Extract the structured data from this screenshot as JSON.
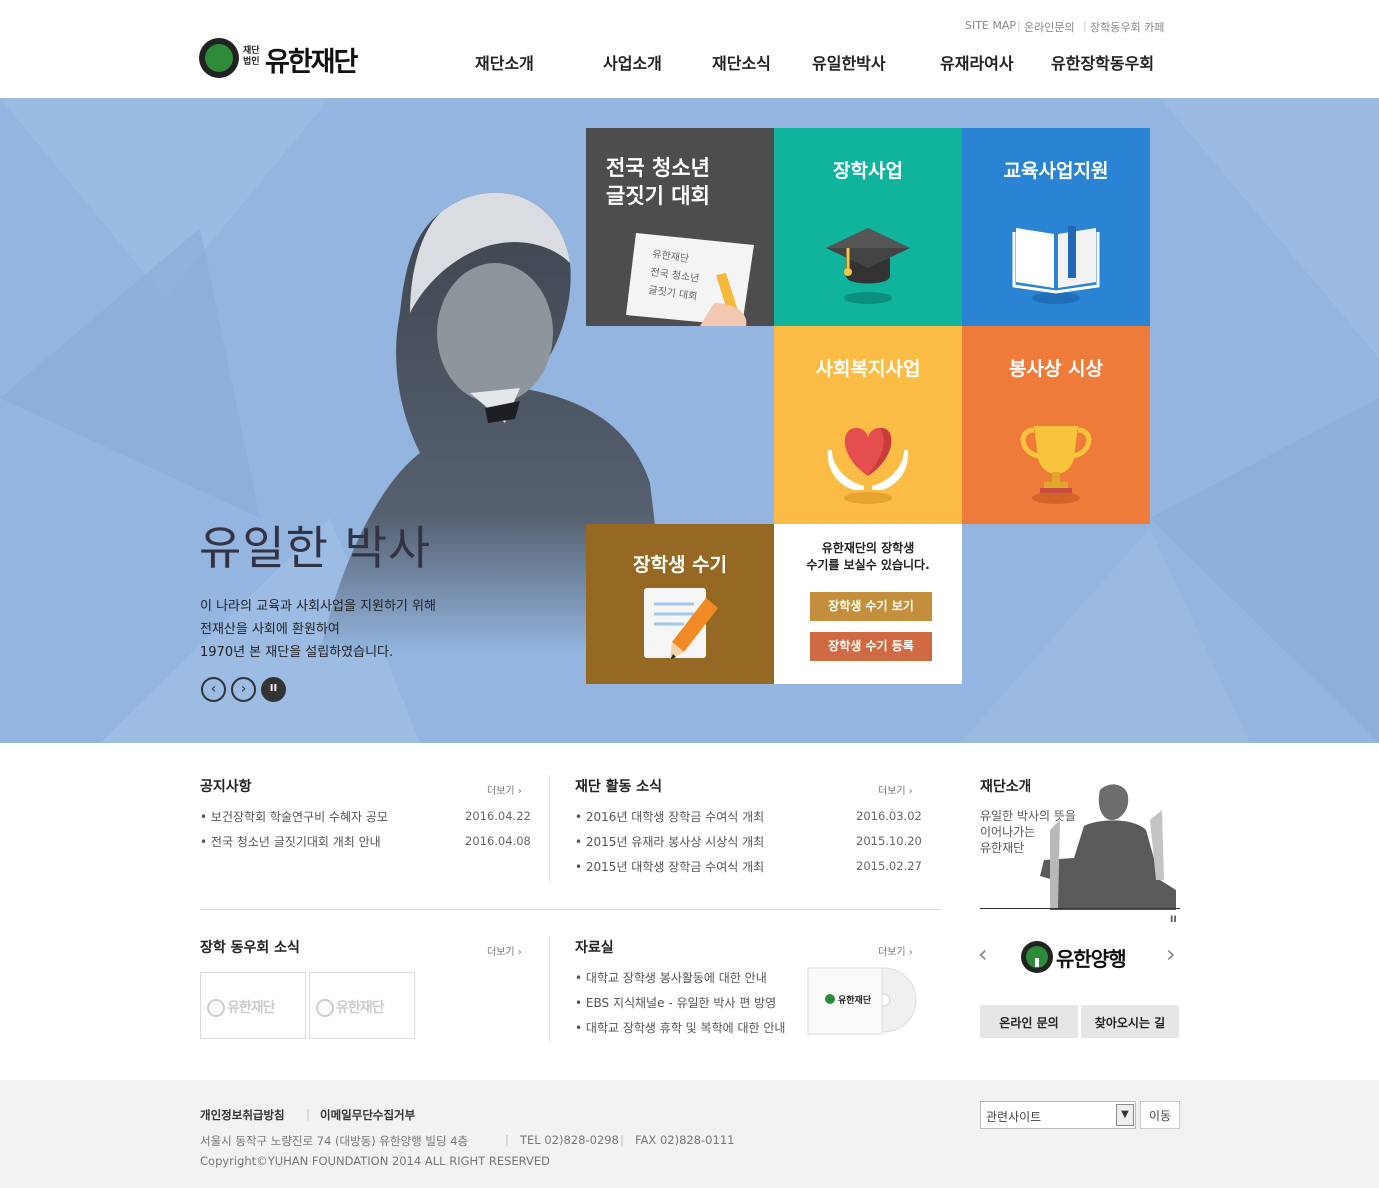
{
  "util": {
    "sitemap": "SITE MAP",
    "inquiry": "온라인문의",
    "cafe": "장학동우회 카페"
  },
  "logo": {
    "small": "재단\n법인",
    "text": "유한재단"
  },
  "gnb": [
    "재단소개",
    "사업소개",
    "재단소식",
    "유일한박사",
    "유재라여사",
    "유한장학동우회"
  ],
  "hero": {
    "title": "유일한 박사",
    "desc": [
      "이 나라의 교육과 사회사업을 지원하기 위해",
      "전재산을 사회에 환원하여",
      "1970년 본 재단을 설립하였습니다."
    ],
    "prev": "‹",
    "next": "›",
    "pause": "II"
  },
  "tiles": {
    "essay": {
      "title1": "전국 청소년",
      "title2": "글짓기 대회",
      "paper": [
        "유한재단",
        "전국 청소년",
        "글짓기 대회"
      ]
    },
    "scholar": {
      "title": "장학사업"
    },
    "edu": {
      "title": "교육사업지원"
    },
    "welfare": {
      "title": "사회복지사업"
    },
    "award": {
      "title": "봉사상 시상"
    },
    "memoir": {
      "title": "장학생 수기",
      "desc1": "유한재단의 장학생",
      "desc2": "수기를 보실수 있습니다.",
      "view": "장학생 수기 보기",
      "register": "장학생 수기 등록"
    }
  },
  "colors": {
    "hero_bg": "#93b5df",
    "essay": "#4d4d4d",
    "scholar": "#10b39c",
    "edu": "#2a84d3",
    "welfare": "#fbbc45",
    "award": "#ef7b3a",
    "memoir": "#956823"
  },
  "notice": {
    "title": "공지사항",
    "more": "더보기 ›",
    "items": [
      {
        "text": "보건장학회 학술연구비 수혜자 공모",
        "date": "2016.04.22"
      },
      {
        "text": "전국 청소년 글짓기대회 개최 안내",
        "date": "2016.04.08"
      }
    ]
  },
  "activity": {
    "title": "재단 활동 소식",
    "more": "더보기 ›",
    "items": [
      {
        "text": "2016년 대학생 장학금 수여식 개최",
        "date": "2016.03.02"
      },
      {
        "text": "2015년 유재라 봉사상 시상식 개최",
        "date": "2015.10.20"
      },
      {
        "text": "2015년 대학생 장학금 수여식 개최",
        "date": "2015.02.27"
      }
    ]
  },
  "alumni": {
    "title": "장학 동우회 소식",
    "more": "더보기 ›",
    "thumb_logo": "유한재단"
  },
  "archive": {
    "title": "자료실",
    "more": "더보기 ›",
    "items": [
      "대학교 장학생 봉사활동에 대한 안내",
      "EBS 지식채널e - 유일한 박사 편 방영",
      "대학교 장학생 휴학 및 복학에 대한 안내"
    ],
    "cd_label": "유한재단"
  },
  "side": {
    "title": "재단소개",
    "desc": [
      "유일한 박사의 뜻을",
      "이어나가는",
      "유한재단"
    ],
    "pause": "II",
    "banner": "유한양행",
    "prev": "‹",
    "next": "›",
    "inquiry": "온라인 문의",
    "directions": "찾아오시는 길"
  },
  "footer": {
    "privacy": "개인정보취급방침",
    "email": "이메일무단수집거부",
    "address": "서울시 동작구 노량진로 74 (대방동) 유한양행 빌딩 4층",
    "tel": "TEL 02)828-0298",
    "fax": "FAX 02)828-0111",
    "copyright": "Copyright©YUHAN FOUNDATION 2014 ALL RIGHT RESERVED",
    "related": "관련사이트",
    "go": "이동"
  }
}
